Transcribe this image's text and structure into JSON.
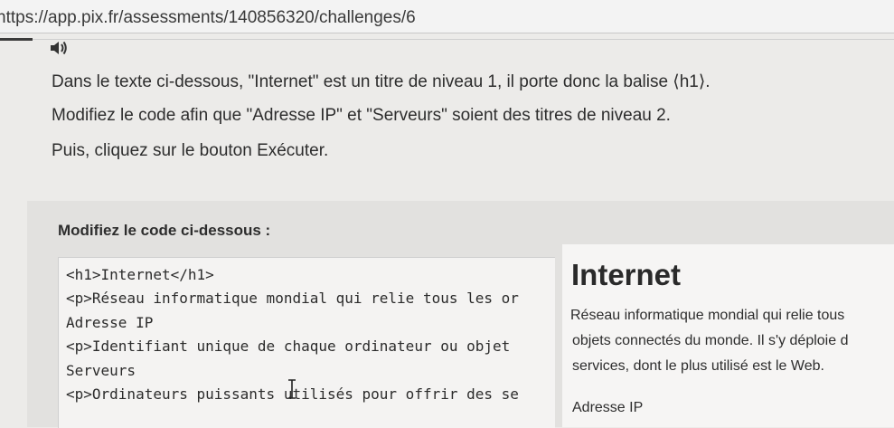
{
  "browser": {
    "url": "nttps://app.pix.fr/assessments/140856320/challenges/6"
  },
  "instructions": {
    "audio_icon": "speaker-icon",
    "line1": "Dans le texte ci-dessous, \"Internet\" est un titre de niveau 1, il porte donc la balise ⟨h1⟩.",
    "line2": "Modifiez le code afin que \"Adresse IP\" et \"Serveurs\" soient des titres de niveau 2.",
    "line3": "Puis, cliquez sur le bouton Exécuter."
  },
  "editor": {
    "title": "Modifiez le code ci-dessous :",
    "lines": [
      "<h1>Internet</h1>",
      "<p>Réseau informatique mondial qui relie tous les or",
      "Adresse IP",
      "<p>Identifiant unique de chaque ordinateur ou objet",
      "Serveurs",
      "<p>Ordinateurs puissants utilisés pour offrir des se"
    ],
    "cursor_icon": "text-cursor-icon"
  },
  "preview": {
    "heading": "Internet",
    "paragraph_lines": [
      "Réseau informatique mondial qui relie tous",
      "objets connectés du monde. Il s'y déploie d",
      "services, dont le plus utilisé est le Web."
    ],
    "next_line": "Adresse IP"
  },
  "colors": {
    "page_bg": "#ecebe9",
    "editor_panel_bg": "#e2e1df",
    "code_bg": "#f4f3f2",
    "preview_bg": "#f6f5f4",
    "text": "#2d2d2d"
  }
}
